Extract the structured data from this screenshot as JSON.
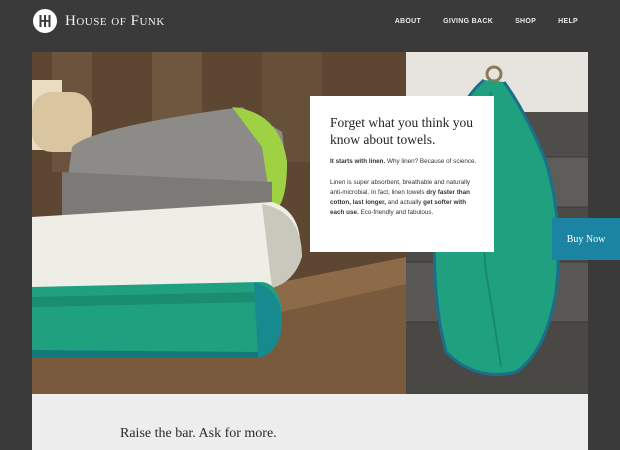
{
  "brand": {
    "name": "House of Funk",
    "logo_icon": "hf-monogram-icon"
  },
  "nav": {
    "items": [
      {
        "label": "ABOUT"
      },
      {
        "label": "GIVING BACK"
      },
      {
        "label": "SHOP"
      },
      {
        "label": "HELP"
      }
    ]
  },
  "promo": {
    "heading": "Forget what you think you know about towels.",
    "intro_bold": "It starts with linen.",
    "intro_rest": " Why linen? Because of science.",
    "body_1": "Linen is super absorbent, breathable and naturally anti-microbial. In fact, linen towels ",
    "body_bold_1": "dry faster than cotton, last longer,",
    "body_2": " and actually ",
    "body_bold_2": "get softer with each use.",
    "body_3": " Eco-friendly and fabulous."
  },
  "cta": {
    "label": "Buy Now",
    "color": "#1b84a3"
  },
  "lower": {
    "tagline": "Raise the bar.  Ask for more."
  },
  "colors": {
    "header_bg": "#3a3a3a",
    "towel_green": "#1fa07f",
    "towel_gray": "#8a8a8a",
    "towel_white": "#efeee8",
    "towel_trim": "#9fd243"
  }
}
